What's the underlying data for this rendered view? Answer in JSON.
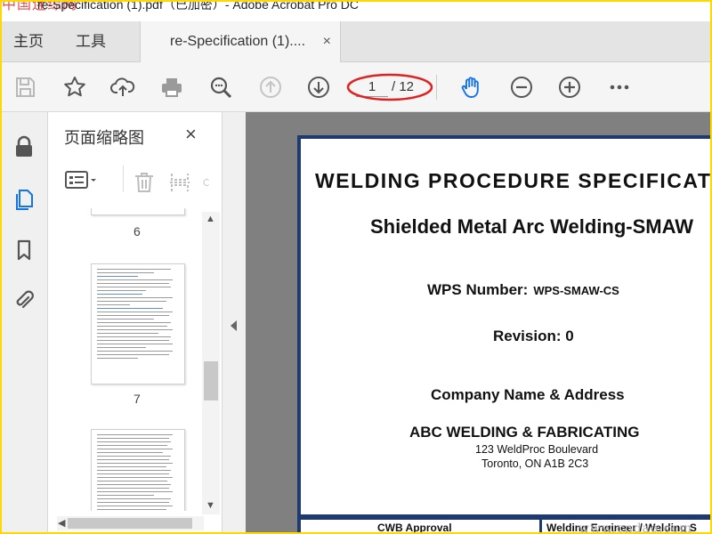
{
  "window": {
    "watermark_top": "中国连综网",
    "title": "re-Specification (1).pdf（已加密）- Adobe Acrobat Pro DC"
  },
  "tabs": {
    "home": "主页",
    "tools": "工具",
    "document": "re-Specification (1)....",
    "close": "×"
  },
  "toolbar": {
    "icons": [
      "save-icon",
      "star-icon",
      "cloud-upload-icon",
      "print-icon",
      "search-icon",
      "page-up-icon",
      "page-down-icon",
      "hand-icon",
      "zoom-out-icon",
      "zoom-in-icon",
      "more-icon"
    ],
    "page_current": "1",
    "page_total": "/ 12"
  },
  "rail": {
    "icons": [
      "lock-icon",
      "page-thumbnails-icon",
      "bookmark-icon",
      "paperclip-icon"
    ]
  },
  "thumbnails_panel": {
    "title": "页面缩略图",
    "close": "×",
    "pages": [
      {
        "label": "6"
      },
      {
        "label": "7"
      }
    ]
  },
  "document": {
    "title": "WELDING PROCEDURE SPECIFICATION",
    "subtitle": "Shielded Metal Arc Welding-SMAW",
    "wps_label": "WPS Number:",
    "wps_value": "WPS-SMAW-CS",
    "revision": "Revision: 0",
    "company_heading": "Company Name & Address",
    "company_name": "ABC WELDING & FABRICATING",
    "address_line1": "123 WeldProc Boulevard",
    "address_line2": "Toronto, ON A1B 2C3",
    "footer_left": "CWB Approval",
    "footer_right": "Welding Engineer / Welding S"
  },
  "watermark_bottom": "www.cndao.com",
  "colors": {
    "accent": "#1473e6",
    "frame": "#ffd800",
    "doc_border": "#1e3a6e",
    "annotation": "#d22"
  }
}
